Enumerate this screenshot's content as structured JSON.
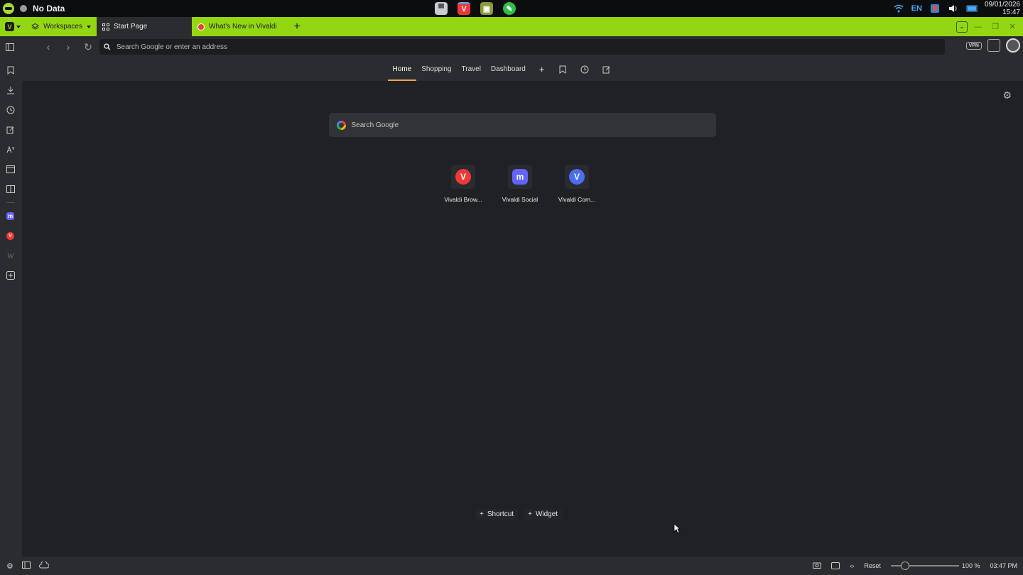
{
  "os": {
    "title": "No Data",
    "lang": "EN",
    "date": "09/01/2026",
    "time": "15:47"
  },
  "tabs": {
    "workspaces_label": "Workspaces",
    "items": [
      {
        "label": "Start Page",
        "active": true
      },
      {
        "label": "What's New in Vivaldi",
        "active": false
      }
    ]
  },
  "address": {
    "placeholder": "Search Google or enter an address",
    "vpn_label": "VPN"
  },
  "start_page": {
    "tabs": [
      "Home",
      "Shopping",
      "Travel",
      "Dashboard"
    ],
    "active_tab": "Home",
    "search_placeholder": "Search Google",
    "speed_dials": [
      {
        "label": "Vivaldi Brow...",
        "icon": "vivaldi-icon"
      },
      {
        "label": "Vivaldi Social",
        "icon": "mastodon-icon"
      },
      {
        "label": "Vivaldi Com...",
        "icon": "vivaldi-community-icon"
      }
    ],
    "add_shortcut": "Shortcut",
    "add_widget": "Widget"
  },
  "status_bar": {
    "reset_label": "Reset",
    "zoom": "100 %",
    "clock": "03:47 PM"
  },
  "colors": {
    "accent": "#93d712",
    "tab_underline": "#f0a64b",
    "background": "#202124"
  }
}
